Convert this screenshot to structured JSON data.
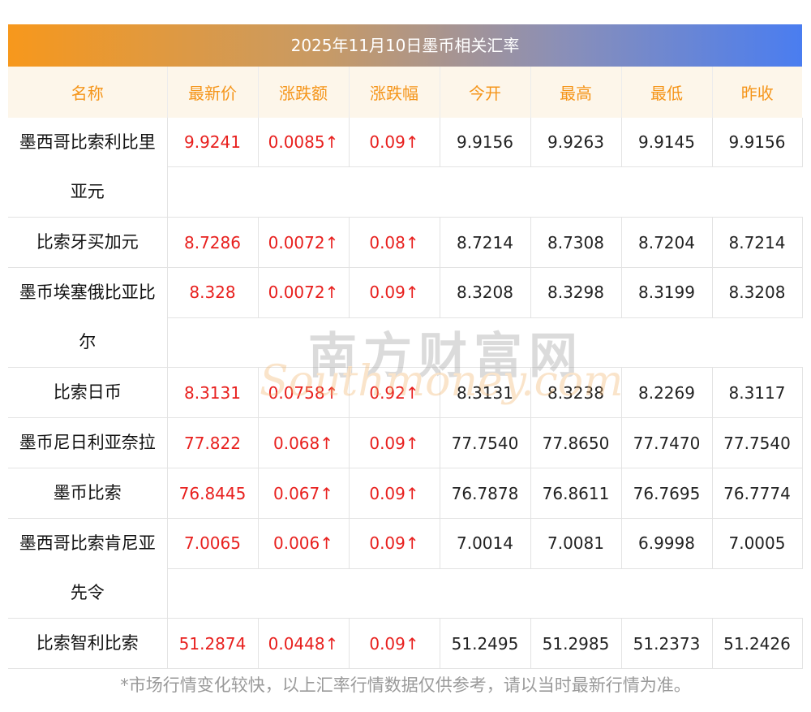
{
  "title": "2025年11月10日墨币相关汇率",
  "headers": [
    "名称",
    "最新价",
    "涨跌额",
    "涨跌幅",
    "今开",
    "最高",
    "最低",
    "昨收"
  ],
  "rows": [
    {
      "name": "墨西哥比索利比里亚元",
      "latest": "9.9241",
      "change": "0.0085↑",
      "pct": "0.09↑",
      "open": "9.9156",
      "high": "9.9263",
      "low": "9.9145",
      "prev": "9.9156",
      "tall": true
    },
    {
      "name": "比索牙买加元",
      "latest": "8.7286",
      "change": "0.0072↑",
      "pct": "0.08↑",
      "open": "8.7214",
      "high": "8.7308",
      "low": "8.7204",
      "prev": "8.7214",
      "tall": false
    },
    {
      "name": "墨币埃塞俄比亚比尔",
      "latest": "8.328",
      "change": "0.0072↑",
      "pct": "0.09↑",
      "open": "8.3208",
      "high": "8.3298",
      "low": "8.3199",
      "prev": "8.3208",
      "tall": true
    },
    {
      "name": "比索日币",
      "latest": "8.3131",
      "change": "0.0758↑",
      "pct": "0.92↑",
      "open": "8.3131",
      "high": "8.3238",
      "low": "8.2269",
      "prev": "8.3117",
      "tall": false
    },
    {
      "name": "墨币尼日利亚奈拉",
      "latest": "77.822",
      "change": "0.068↑",
      "pct": "0.09↑",
      "open": "77.7540",
      "high": "77.8650",
      "low": "77.7470",
      "prev": "77.7540",
      "tall": false
    },
    {
      "name": "墨币比索",
      "latest": "76.8445",
      "change": "0.067↑",
      "pct": "0.09↑",
      "open": "76.7878",
      "high": "76.8611",
      "low": "76.7695",
      "prev": "76.7774",
      "tall": false
    },
    {
      "name": "墨西哥比索肯尼亚先令",
      "latest": "7.0065",
      "change": "0.006↑",
      "pct": "0.09↑",
      "open": "7.0014",
      "high": "7.0081",
      "low": "6.9998",
      "prev": "7.0005",
      "tall": true
    },
    {
      "name": "比索智利比索",
      "latest": "51.2874",
      "change": "0.0448↑",
      "pct": "0.09↑",
      "open": "51.2495",
      "high": "51.2985",
      "low": "51.2373",
      "prev": "51.2426",
      "tall": false
    }
  ],
  "watermark": {
    "cn": "南方财富网",
    "en": "Southmoney.com"
  },
  "footnote": "*市场行情变化较快，以上汇率行情数据仅供参考，请以当时最新行情为准。",
  "colors": {
    "up": "#e8201e",
    "header_text": "#f5951a",
    "header_bg": "#fdf6ea"
  }
}
